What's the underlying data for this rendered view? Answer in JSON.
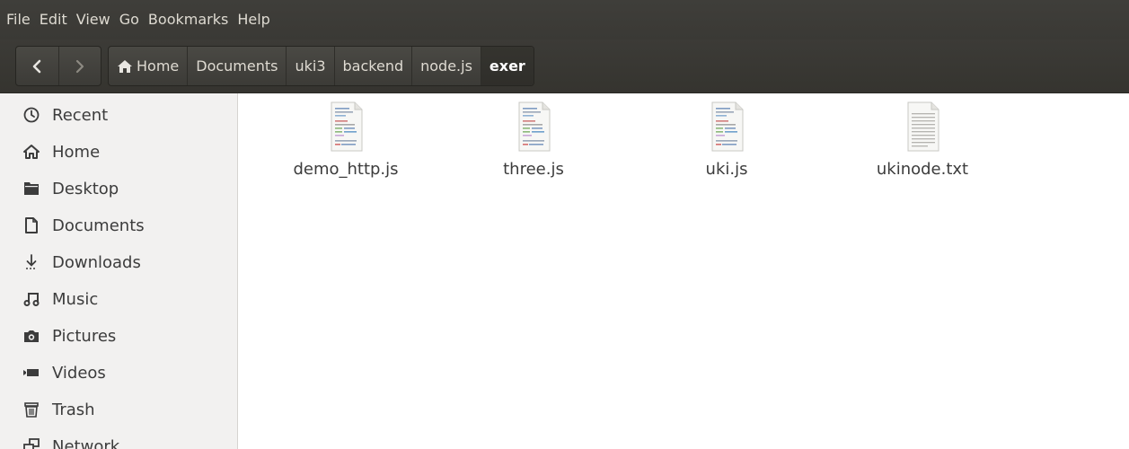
{
  "menubar": {
    "items": [
      "File",
      "Edit",
      "View",
      "Go",
      "Bookmarks",
      "Help"
    ]
  },
  "nav": {
    "back_icon": "chevron-left-icon",
    "forward_icon": "chevron-right-icon"
  },
  "breadcrumb": {
    "items": [
      "Home",
      "Documents",
      "uki3",
      "backend",
      "node.js",
      "exer"
    ]
  },
  "sidebar": {
    "items": [
      {
        "label": "Recent",
        "icon": "clock-icon"
      },
      {
        "label": "Home",
        "icon": "home-icon"
      },
      {
        "label": "Desktop",
        "icon": "folder-icon"
      },
      {
        "label": "Documents",
        "icon": "document-icon"
      },
      {
        "label": "Downloads",
        "icon": "download-icon"
      },
      {
        "label": "Music",
        "icon": "music-icon"
      },
      {
        "label": "Pictures",
        "icon": "camera-icon"
      },
      {
        "label": "Videos",
        "icon": "video-icon"
      },
      {
        "label": "Trash",
        "icon": "trash-icon"
      },
      {
        "label": "Network",
        "icon": "network-icon"
      }
    ]
  },
  "files": [
    {
      "name": "demo_http.js",
      "type": "script"
    },
    {
      "name": "three.js",
      "type": "script"
    },
    {
      "name": "uki.js",
      "type": "script"
    },
    {
      "name": "ukinode.txt",
      "type": "text"
    }
  ],
  "colors": {
    "toolbar": "#3c3b37",
    "sidebar": "#f2f1f0",
    "text": "#3c3c3c"
  }
}
